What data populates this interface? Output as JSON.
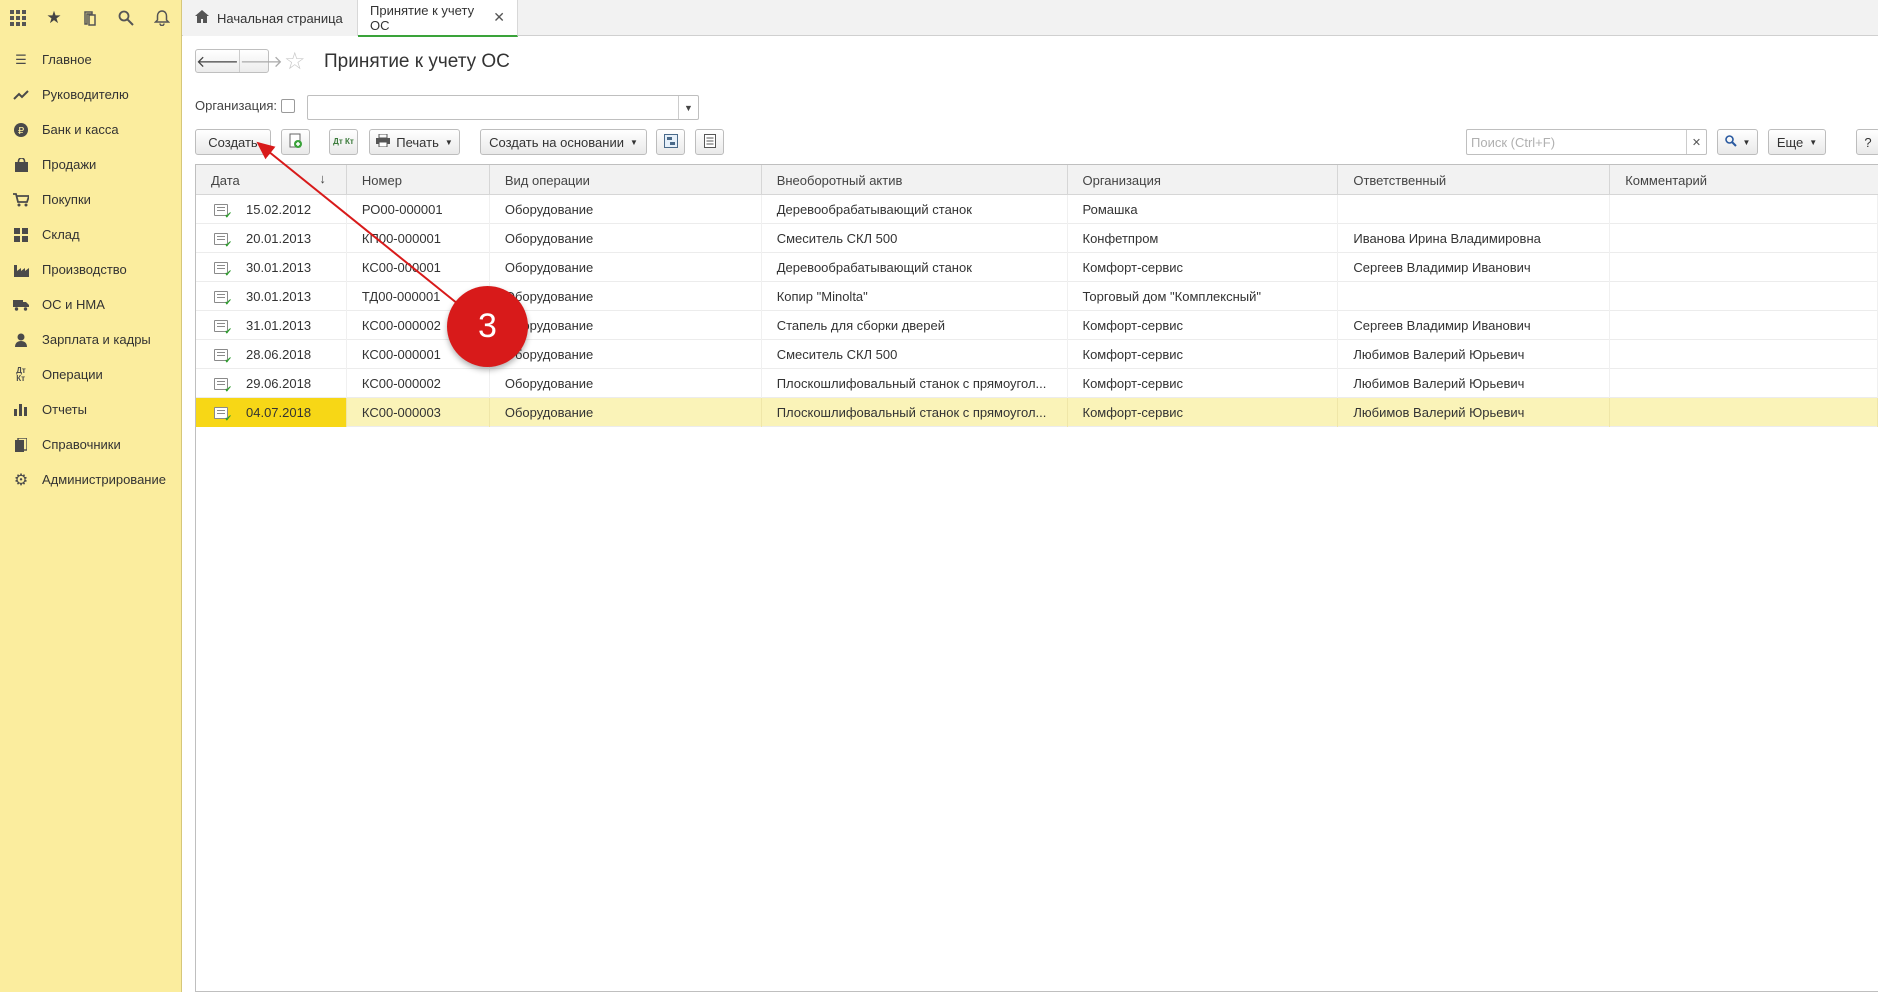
{
  "topbar": {
    "icons": [
      "apps-grid-icon",
      "favorites-star-icon",
      "history-icon",
      "search-icon",
      "notifications-bell-icon"
    ],
    "tabs": [
      {
        "label": "Начальная страница",
        "icon": "home-icon"
      },
      {
        "label": "Принятие к учету ОС",
        "active": true
      }
    ]
  },
  "sidebar": {
    "items": [
      {
        "label": "Главное",
        "icon": "menu-lines-icon"
      },
      {
        "label": "Руководителю",
        "icon": "trend-up-icon"
      },
      {
        "label": "Банк и касса",
        "icon": "ruble-coin-icon"
      },
      {
        "label": "Продажи",
        "icon": "shopping-bag-icon"
      },
      {
        "label": "Покупки",
        "icon": "cart-icon"
      },
      {
        "label": "Склад",
        "icon": "warehouse-grid-icon"
      },
      {
        "label": "Производство",
        "icon": "factory-icon"
      },
      {
        "label": "ОС и НМА",
        "icon": "truck-icon"
      },
      {
        "label": "Зарплата и кадры",
        "icon": "person-icon"
      },
      {
        "label": "Операции",
        "icon": "debit-credit-icon"
      },
      {
        "label": "Отчеты",
        "icon": "bar-chart-icon"
      },
      {
        "label": "Справочники",
        "icon": "books-icon"
      },
      {
        "label": "Администрирование",
        "icon": "gear-icon"
      }
    ]
  },
  "page": {
    "title": "Принятие к учету ОС",
    "org_label": "Организация:",
    "org_value": ""
  },
  "toolbar": {
    "create": "Создать",
    "print": "Печать",
    "create_based": "Создать на основании",
    "search_placeholder": "Поиск (Ctrl+F)",
    "more": "Еще",
    "help": "?",
    "dtkt": "Дт Кт"
  },
  "table": {
    "columns": [
      "Дата",
      "Номер",
      "Вид операции",
      "Внеоборотный актив",
      "Организация",
      "Ответственный",
      "Комментарий"
    ],
    "rows": [
      {
        "date": "15.02.2012",
        "number": "РО00-000001",
        "op": "Оборудование",
        "asset": "Деревообрабатывающий станок",
        "org": "Ромашка",
        "resp": "",
        "comment": ""
      },
      {
        "date": "20.01.2013",
        "number": "КП00-000001",
        "op": "Оборудование",
        "asset": "Смеситель СКЛ 500",
        "org": "Конфетпром",
        "resp": "Иванова Ирина Владимировна",
        "comment": ""
      },
      {
        "date": "30.01.2013",
        "number": "КС00-000001",
        "op": "Оборудование",
        "asset": "Деревообрабатывающий станок",
        "org": "Комфорт-сервис",
        "resp": "Сергеев Владимир Иванович",
        "comment": ""
      },
      {
        "date": "30.01.2013",
        "number": "ТД00-000001",
        "op": "Оборудование",
        "asset": "Копир \"Minolta\"",
        "org": "Торговый дом \"Комплексный\"",
        "resp": "",
        "comment": ""
      },
      {
        "date": "31.01.2013",
        "number": "КС00-000002",
        "op": "Оборудование",
        "asset": "Стапель для сборки дверей",
        "org": "Комфорт-сервис",
        "resp": "Сергеев Владимир Иванович",
        "comment": ""
      },
      {
        "date": "28.06.2018",
        "number": "КС00-000001",
        "op": "Оборудование",
        "asset": "Смеситель СКЛ 500",
        "org": "Комфорт-сервис",
        "resp": "Любимов Валерий Юрьевич",
        "comment": ""
      },
      {
        "date": "29.06.2018",
        "number": "КС00-000002",
        "op": "Оборудование",
        "asset": "Плоскошлифовальный станок с прямоугол...",
        "org": "Комфорт-сервис",
        "resp": "Любимов Валерий Юрьевич",
        "comment": ""
      },
      {
        "date": "04.07.2018",
        "number": "КС00-000003",
        "op": "Оборудование",
        "asset": "Плоскошлифовальный станок с прямоугол...",
        "org": "Комфорт-сервис",
        "resp": "Любимов Валерий Юрьевич",
        "comment": "",
        "selected": true
      }
    ]
  },
  "annotation": {
    "step": "3",
    "color": "#d81a1a"
  }
}
